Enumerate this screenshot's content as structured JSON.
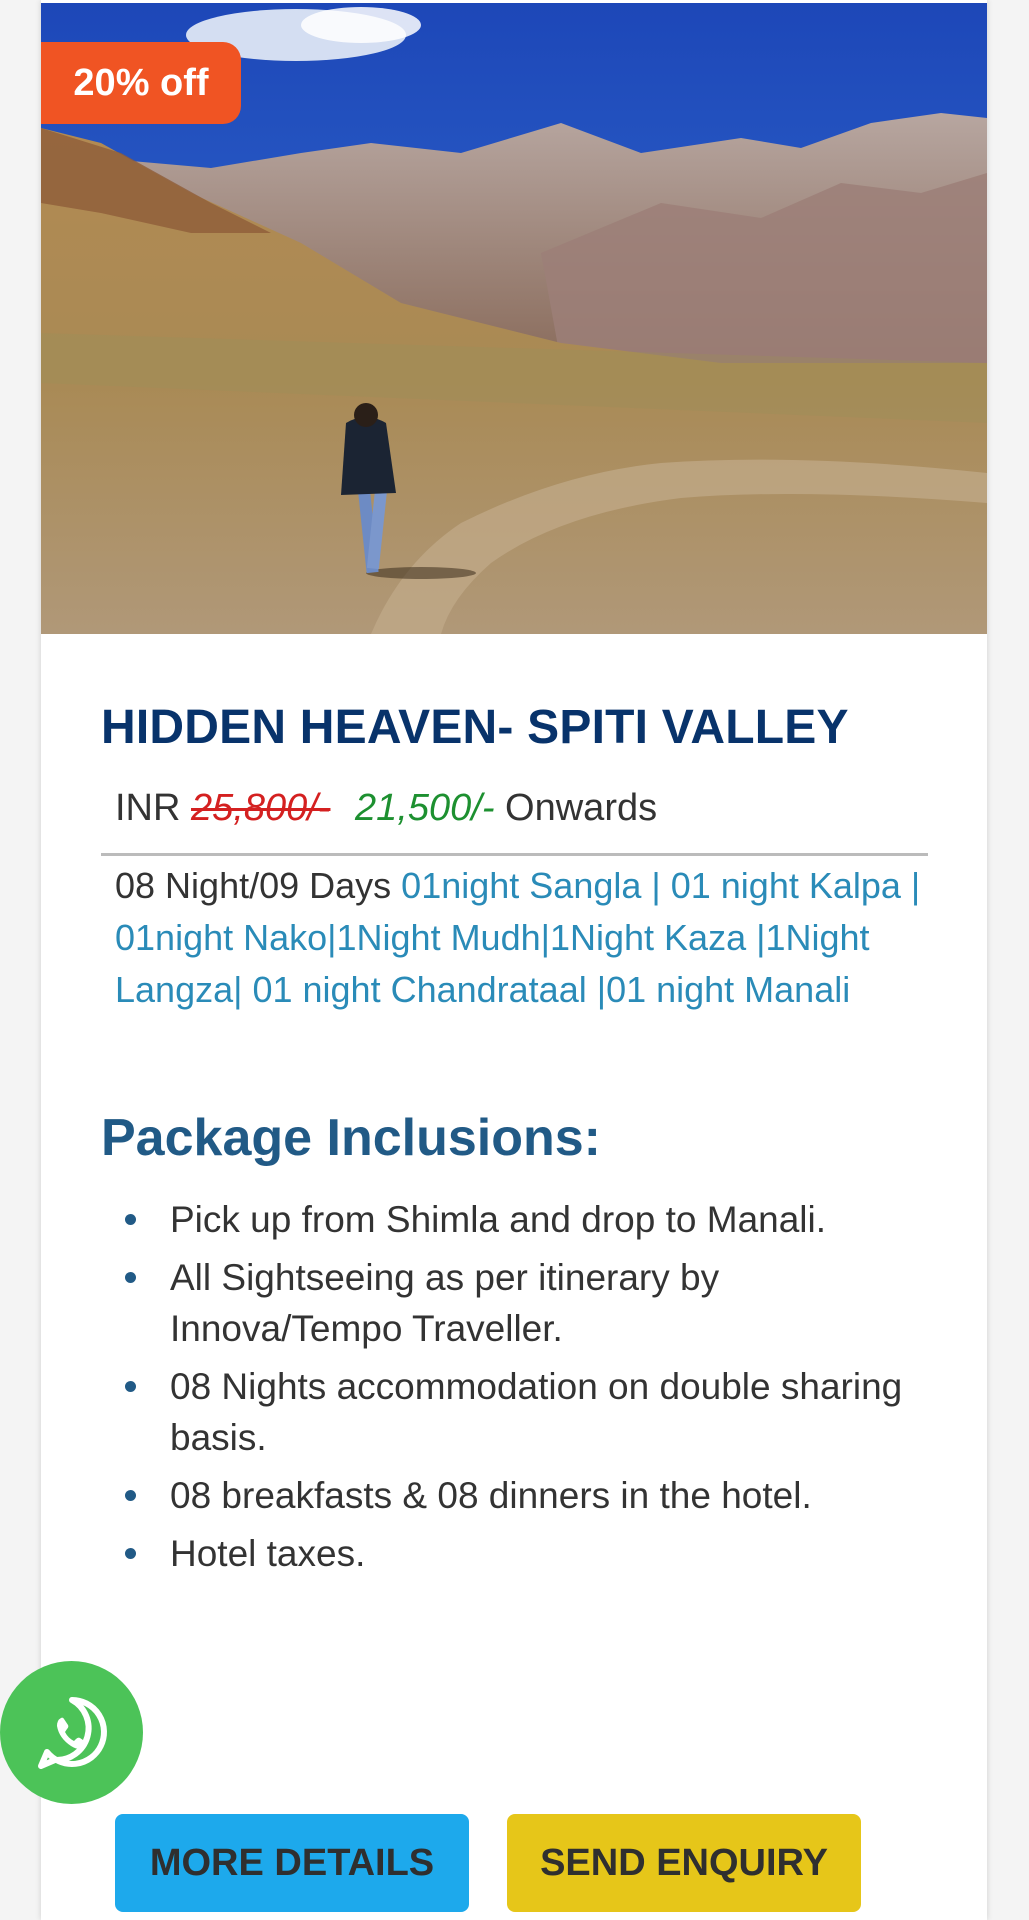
{
  "badge": {
    "label": "20% off"
  },
  "hero": {
    "image_description": ""
  },
  "package": {
    "title": "HIDDEN HEAVEN- SPITI VALLEY",
    "currency": "INR",
    "old_price": "25,800/-",
    "new_price": "21,500/-",
    "price_suffix": "Onwards",
    "duration": "08 Night/09 Days",
    "route": "01night Sangla | 01 night Kalpa | 01night Nako|1Night Mudh|1Night Kaza |1Night Langza| 01 night Chandrataal |01 night Manali"
  },
  "inclusions": {
    "heading": "Package Inclusions:",
    "items": [
      "Pick up from Shimla and drop to Manali.",
      "All Sightseeing as per itinerary by Innova/Tempo Traveller.",
      "08 Nights accommodation on double sharing basis.",
      "08 breakfasts & 08 dinners in the hotel.",
      "Hotel taxes."
    ]
  },
  "buttons": {
    "more_details": "MORE DETAILS",
    "send_enquiry": "SEND ENQUIRY"
  },
  "colors": {
    "badge": "#f05423",
    "title": "#08336b",
    "old_price": "#d42020",
    "new_price": "#1d9030",
    "route_text": "#2a8bb8",
    "heading": "#215a86",
    "more_details_bg": "#1da9ec",
    "send_enquiry_bg": "#e6c619",
    "whatsapp": "#4cc358"
  },
  "icons": {
    "whatsapp": "whatsapp-icon",
    "bullet": "bullet-dot-icon"
  }
}
